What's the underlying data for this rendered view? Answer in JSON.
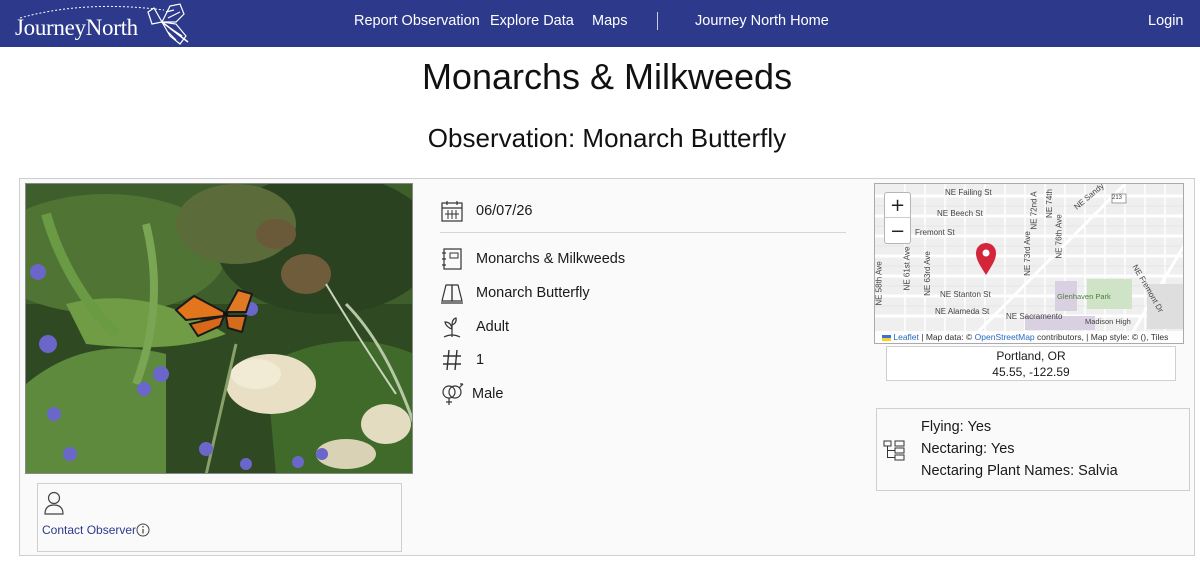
{
  "nav": {
    "logo_text": "JourneyNorth",
    "links": [
      {
        "label": "Report Observation"
      },
      {
        "label": "Explore Data"
      },
      {
        "label": "Maps"
      },
      {
        "label": "Journey North Home"
      }
    ],
    "login_label": "Login"
  },
  "page": {
    "title": "Monarchs & Milkweeds",
    "observation_title": "Observation: Monarch Butterfly"
  },
  "observation": {
    "date": "06/07/26",
    "project": "Monarchs & Milkweeds",
    "species": "Monarch Butterfly",
    "life_stage": "Adult",
    "count": "1",
    "sex": "Male"
  },
  "contact": {
    "label": "Contact Observer"
  },
  "map": {
    "zoom_in": "+",
    "zoom_out": "−",
    "attribution": {
      "leaflet": "Leaflet",
      "map_data": "| Map data: ©",
      "osm": "OpenStreetMap",
      "rest": "contributors, | Map style: © (), Tiles"
    },
    "streets": [
      "NE Failing St",
      "NE Beech St",
      "Fremont St",
      "NE Stanton St",
      "NE Alameda St",
      "NE Sacramento",
      "NE 58th Ave",
      "NE 61st Ave",
      "NE 63rd Ave",
      "NE 72nd A",
      "NE 74th",
      "NE 73rd Ave",
      "NE 76th Ave",
      "NE Sandy",
      "NE Fremont Dr",
      "Glenhaven Park",
      "Madison High",
      "213"
    ],
    "marker_color": "#d3263a"
  },
  "location": {
    "place": "Portland, OR",
    "coords": "45.55, -122.59"
  },
  "attributes": {
    "flying": "Flying: Yes",
    "nectaring": "Nectaring: Yes",
    "plants": "Nectaring Plant Names: Salvia"
  },
  "colors": {
    "nav_bg": "#2d3a8c",
    "link": "#2d3a8c"
  }
}
